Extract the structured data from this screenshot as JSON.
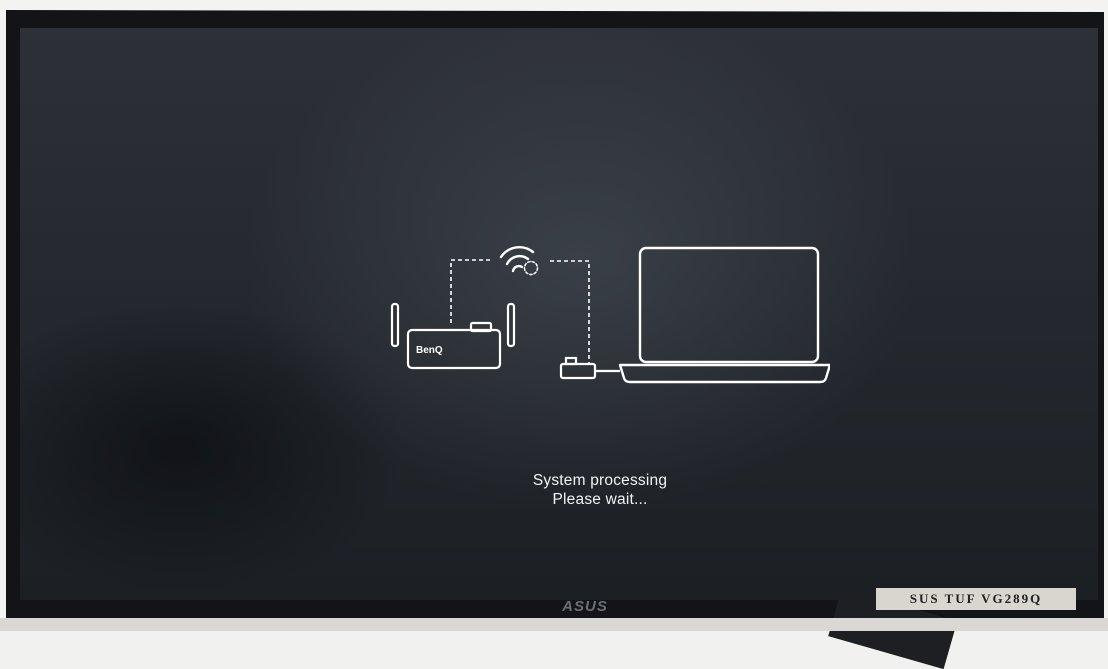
{
  "screen": {
    "status_line_1": "System processing",
    "status_line_2": "Please wait...",
    "device_brand": "BenQ"
  },
  "monitor": {
    "brand": "ASUS",
    "model_label": "SUS TUF VG289Q"
  },
  "icons": {
    "wifi": "wifi-icon",
    "receiver": "benq-receiver-icon",
    "button": "usb-button-icon",
    "laptop": "laptop-icon"
  },
  "colors": {
    "screen_background": "#25292f",
    "illustration_stroke": "#ffffff"
  }
}
